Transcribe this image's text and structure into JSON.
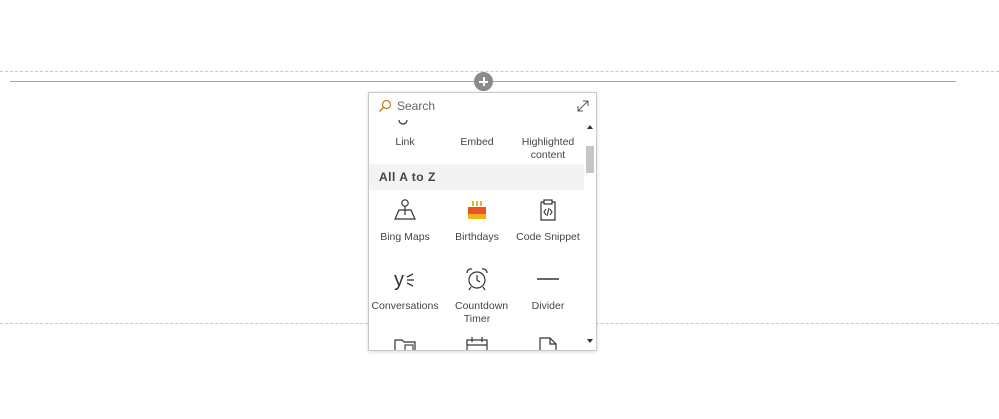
{
  "canvas": {
    "add_section_tooltip": ""
  },
  "toolbox": {
    "search_placeholder": "Search",
    "featured_items": [
      {
        "label": "Link",
        "icon": "link-icon"
      },
      {
        "label": "Embed",
        "icon": "embed-icon"
      },
      {
        "label": "Highlighted content",
        "icon": "highlighted-content-icon"
      }
    ],
    "section_title": "All A to Z",
    "all_items": [
      {
        "label": "Bing Maps",
        "icon": "map-pin-icon"
      },
      {
        "label": "Birthdays",
        "icon": "birthday-cake-icon"
      },
      {
        "label": "Code Snippet",
        "icon": "code-clipboard-icon"
      },
      {
        "label": "Conversations",
        "icon": "yammer-icon"
      },
      {
        "label": "Countdown Timer",
        "icon": "alarm-clock-icon"
      },
      {
        "label": "Divider",
        "icon": "divider-line-icon"
      }
    ]
  },
  "colors": {
    "birthday_cake": "#e8532b",
    "birthday_candles": "#f3b21a",
    "search_icon": "#c07a1a"
  }
}
